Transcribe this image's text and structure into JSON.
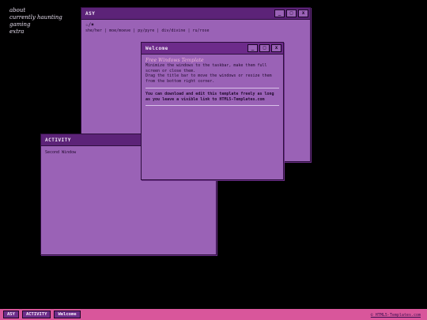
{
  "nav": {
    "links": [
      "about",
      "currently haunting",
      "gaming",
      "extra"
    ]
  },
  "asy_window": {
    "title": "ASY",
    "star_line": "☆/✖",
    "pronouns": "she/her | moe/moeve | py/pyre | div/divine | ru/rose"
  },
  "welcome_window": {
    "title": "Welcome",
    "heading": "Free Windows Template",
    "para1": "Minimize the windows to the taskbar, make them full screen or close them.",
    "para2": "Drag the title bar to move the windows or resize them from the bottom right corner.",
    "para3": "You can download and edit this template freely as long as you leave a visible link to HTML5-Templates.com"
  },
  "activity_window": {
    "title": "ACTIVITY",
    "text": "Second Window"
  },
  "controls": {
    "minimize": "_",
    "maximize": "□",
    "close": "x"
  },
  "taskbar": {
    "buttons": [
      "ASY",
      "ACTIVITY",
      "Welcome"
    ],
    "credit": "© HTML5-Templates.com"
  },
  "colors": {
    "window_bg": "#9a62b6",
    "titlebar": "#5c2378",
    "taskbar": "#d9569b",
    "desktop": "#000000"
  }
}
